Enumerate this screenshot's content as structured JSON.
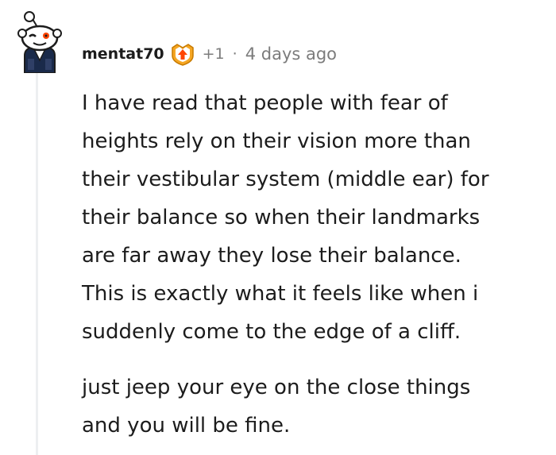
{
  "comment": {
    "username": "mentat70",
    "points": "+1",
    "separator": "·",
    "timestamp": "4 days ago",
    "avatar_icon": "reddit-snoo-avatar-icon",
    "flair_icon": "heart-up-arrow-award-icon",
    "paragraphs": [
      "I have read that people with fear of\nheights rely on their vision more than\ntheir vestibular system (middle ear) for\ntheir balance so when their landmarks\nare far away they lose their balance.\nThis is exactly what it feels like when i\nsuddenly come to the edge of a cliff.",
      "just jeep your eye on the close things\nand you will be fine."
    ]
  },
  "colors": {
    "text": "#1c1c1c",
    "meta": "#7c7c7c",
    "thread_line": "#edeff1",
    "award_orange": "#f5a623",
    "award_red": "#ff4500"
  }
}
